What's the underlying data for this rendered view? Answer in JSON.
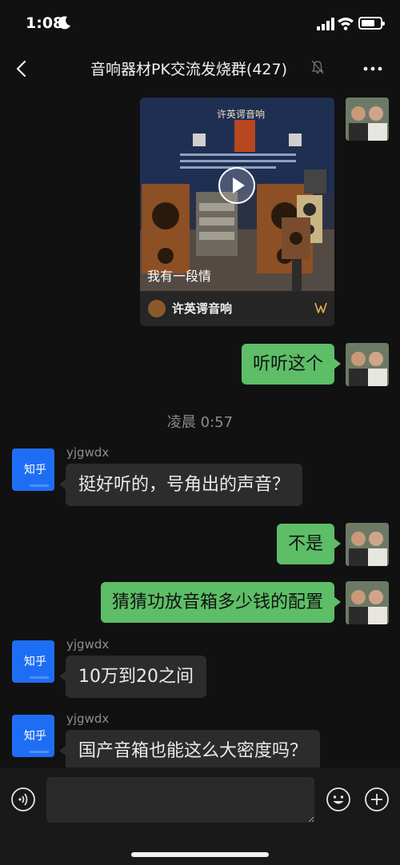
{
  "status_bar": {
    "time": "1:08"
  },
  "header": {
    "title": "音响器材PK交流发烧群(427)"
  },
  "video_card": {
    "caption": "我有一段情",
    "channel_name": "许英谔音响",
    "poster_banner": "许英谔音响"
  },
  "messages": {
    "m1": {
      "text": "听听这个"
    },
    "timestamp": "凌晨 0:57",
    "m2": {
      "sender": "yjgwdx",
      "text": "挺好听的，号角出的声音？"
    },
    "m3": {
      "text": "不是"
    },
    "m4": {
      "text": "猜猜功放音箱多少钱的配置"
    },
    "m5": {
      "sender": "yjgwdx",
      "text": "10万到20之间"
    },
    "m6": {
      "sender": "yjgwdx",
      "text": "国产音箱也能这么大密度吗？"
    }
  },
  "avatars": {
    "other_badge": "知乎"
  },
  "colors": {
    "background": "#111111",
    "bubble_me": "#5dbe67",
    "bubble_other": "#2c2c2c",
    "avatar_other": "#1e6ef5"
  },
  "icons": [
    "back-icon",
    "mute-icon",
    "more-icon",
    "play-icon",
    "voice-icon",
    "emoji-icon",
    "plus-icon"
  ]
}
